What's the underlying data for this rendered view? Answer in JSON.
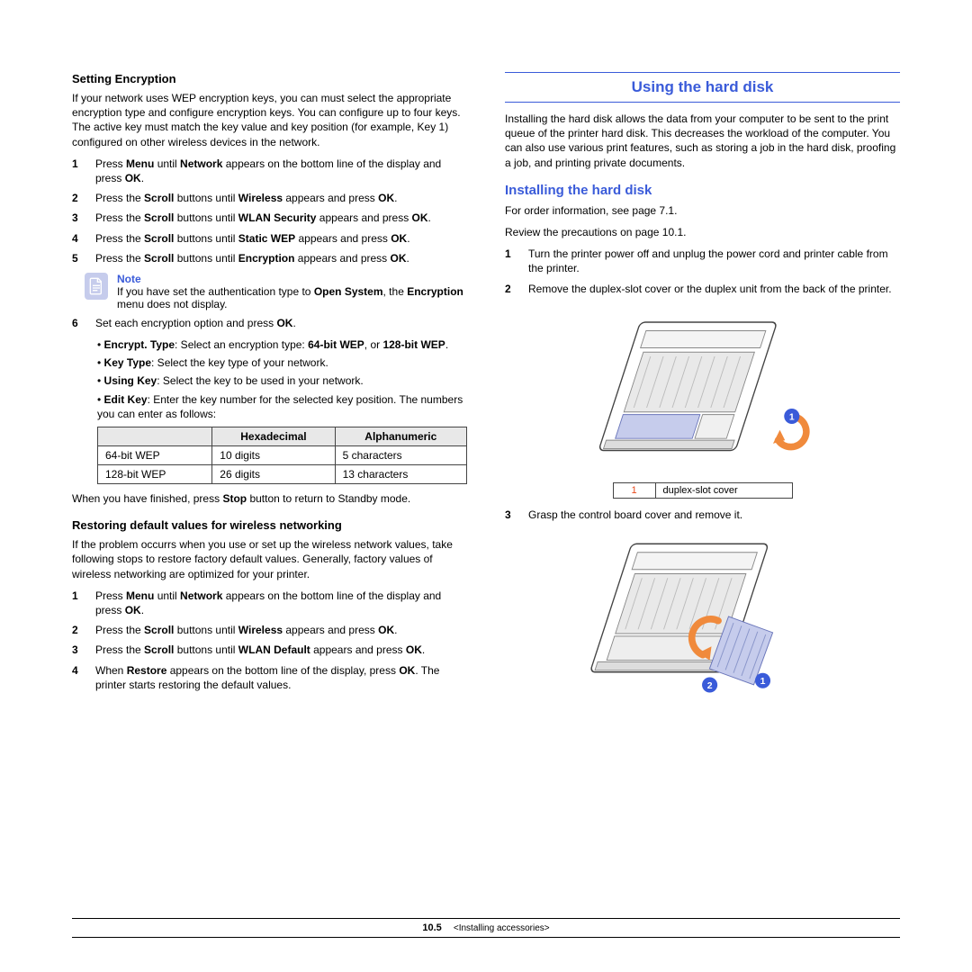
{
  "left": {
    "h1": "Setting Encryption",
    "intro": "If your network uses WEP encryption keys, you can must select the appropriate encryption type and configure encryption keys. You can configure up to four keys. The active key must match the key value and key position (for example, Key 1) configured on other wireless devices in the network.",
    "steps": [
      {
        "n": "1",
        "html": "Press <b>Menu</b> until <b>Network</b> appears on the bottom line of the display and press <b>OK</b>."
      },
      {
        "n": "2",
        "html": "Press the <b>Scroll</b> buttons until <b>Wireless</b> appears and press <b>OK</b>."
      },
      {
        "n": "3",
        "html": "Press the <b>Scroll</b> buttons until <b>WLAN Security</b> appears and press <b>OK</b>."
      },
      {
        "n": "4",
        "html": "Press the <b>Scroll</b> buttons until <b>Static WEP</b> appears and press <b>OK</b>."
      },
      {
        "n": "5",
        "html": "Press the <b>Scroll</b> buttons until <b>Encryption</b> appears and press <b>OK</b>."
      }
    ],
    "note_title": "Note",
    "note_body": "If you have set the authentication type to <b>Open System</b>, the <b>Encryption</b> menu does not display.",
    "step6": {
      "n": "6",
      "html": "Set each encryption option and press <b>OK</b>."
    },
    "bullets": [
      "<b>Encrypt. Type</b>: Select an encryption type: <b>64-bit WEP</b>, or <b>128-bit WEP</b>.",
      "<b>Key Type</b>: Select the key type of your network.",
      "<b>Using Key</b>: Select the key to be used in your network.",
      "<b>Edit Key</b>: Enter the key number for the selected key position. The numbers you can enter as follows:"
    ],
    "table": {
      "headers": [
        "",
        "Hexadecimal",
        "Alphanumeric"
      ],
      "rows": [
        [
          "64-bit WEP",
          "10 digits",
          "5 characters"
        ],
        [
          "128-bit WEP",
          "26 digits",
          "13 characters"
        ]
      ]
    },
    "closing": "When you have finished, press <b>Stop</b> button to return to Standby mode.",
    "h2": "Restoring default values for wireless networking",
    "intro2": "If the problem occurrs when you use or set up the wireless network values, take following stops to restore factory default values. Generally, factory values of wireless networking are optimized for your printer.",
    "steps2": [
      {
        "n": "1",
        "html": "Press <b>Menu</b> until <b>Network</b> appears on the bottom line of the display and press <b>OK</b>."
      },
      {
        "n": "2",
        "html": "Press the <b>Scroll</b> buttons until <b>Wireless</b> appears and press <b>OK</b>."
      },
      {
        "n": "3",
        "html": "Press the <b>Scroll</b> buttons until <b>WLAN Default</b> appears and press <b>OK</b>."
      },
      {
        "n": "4",
        "html": "When  <b>Restore</b> appears on the bottom line of the display, press <b>OK</b>. The printer starts restoring the default values."
      }
    ]
  },
  "right": {
    "h1": "Using the hard disk",
    "intro": "Installing the hard disk allows the data from your computer to be sent to the print queue of the printer hard disk. This decreases the workload of the computer. You can also use various print features, such as storing a job in the hard disk, proofing a job, and printing private documents.",
    "h2": "Installing the hard disk",
    "p1": "For order information, see page 7.1.",
    "p2": "Review the precautions on page 10.1.",
    "steps": [
      {
        "n": "1",
        "html": "Turn the printer power off and unplug the power cord and printer cable from the printer."
      },
      {
        "n": "2",
        "html": "Remove the duplex-slot cover or the duplex unit from the back of the printer."
      }
    ],
    "caption1": {
      "num": "1",
      "label": "duplex-slot cover"
    },
    "step3": {
      "n": "3",
      "html": "Grasp the control board cover and remove it."
    }
  },
  "footer": {
    "page": "10.5",
    "section": "<Installing accessories>"
  }
}
